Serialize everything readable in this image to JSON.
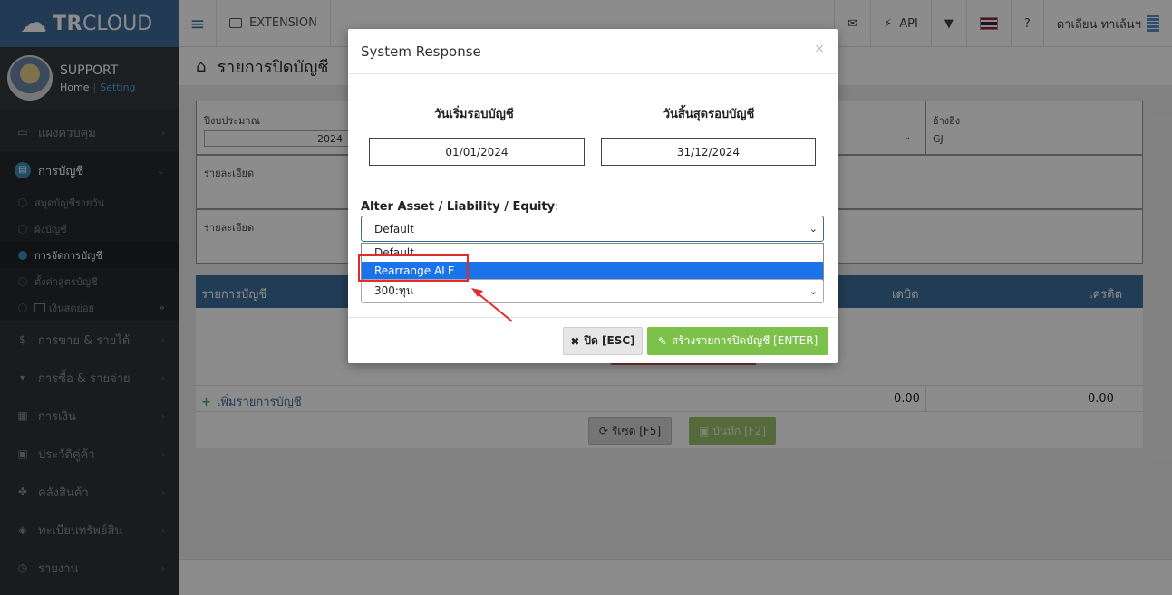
{
  "brand": {
    "tr": "TR",
    "cloud": "CLOUD"
  },
  "user": {
    "name": "SUPPORT",
    "home": "Home",
    "sep": "|",
    "setting": "Setting"
  },
  "sidebar": {
    "items": [
      {
        "label": "แผงควบคุม",
        "icon": "monitor-icon"
      },
      {
        "label": "การบัญชี",
        "icon": "book-icon"
      },
      {
        "label": "การขาย & รายได้",
        "icon": "dollar-icon"
      },
      {
        "label": "การซื้อ & รายจ่าย",
        "icon": "cart-icon"
      },
      {
        "label": "การเงิน",
        "icon": "calendar-icon"
      },
      {
        "label": "ประวัติคู่ค้า",
        "icon": "contact-icon"
      },
      {
        "label": "คลังสินค้า",
        "icon": "cubes-icon"
      },
      {
        "label": "ทะเบียนทรัพย์สิน",
        "icon": "diamond-icon"
      },
      {
        "label": "รายงาน",
        "icon": "report-icon"
      }
    ],
    "subitems": [
      {
        "label": "สมุดบัญชีรายวัน"
      },
      {
        "label": "ผังบัญชี"
      },
      {
        "label": "การจัดการบัญชี"
      },
      {
        "label": "ตั้งค่าสูตรบัญชี"
      },
      {
        "label": "เงินสดย่อย"
      }
    ],
    "double_chevron": "»"
  },
  "topbar": {
    "extension": "EXTENSION",
    "api": "API",
    "user_name": "ดาเลียน ทาเล้นฯ"
  },
  "page": {
    "title": "รายการปิดบัญชี"
  },
  "form": {
    "fiscal_year_label": "ปีงบประมาณ",
    "fiscal_year_value": "2024",
    "ref_label": "อ้างอิง",
    "ref_value": "GJ",
    "detail_label_1": "รายละเอียด",
    "detail_label_2": "รายละเอียด"
  },
  "table": {
    "col_account": "รายการบัญชี",
    "col_debit": "เดบิต",
    "col_credit": "เครดิต",
    "add_account": "เพิ่มรายการบัญชี",
    "total_debit": "0.00",
    "total_credit": "0.00",
    "reset_button": "รีเซต [F5]",
    "save_button": "บันทึก [F2]"
  },
  "modal": {
    "title": "System Response",
    "close_x": "×",
    "start_date_label": "วันเริ่มรอบบัญชี",
    "end_date_label": "วันสิ้นสุดรอบบัญชี",
    "start_date": "01/01/2024",
    "end_date": "31/12/2024",
    "ale_label": "Alter Asset / Liability / Equity",
    "ale_colon": ":",
    "ale_selected": "Default",
    "ale_options": [
      "Default",
      "Rearrange ALE"
    ],
    "equity_selected": "300:ทุน",
    "close_button": "ปิด [ESC]",
    "create_button": "สร้างรายการปิดบัญชี [ENTER]"
  },
  "colors": {
    "brand": "#3e6b9a",
    "sidebar_bg": "#2e3236",
    "highlight": "#e32b2b",
    "option_selected": "#1a73e8",
    "create_button": "#7cc24a"
  }
}
